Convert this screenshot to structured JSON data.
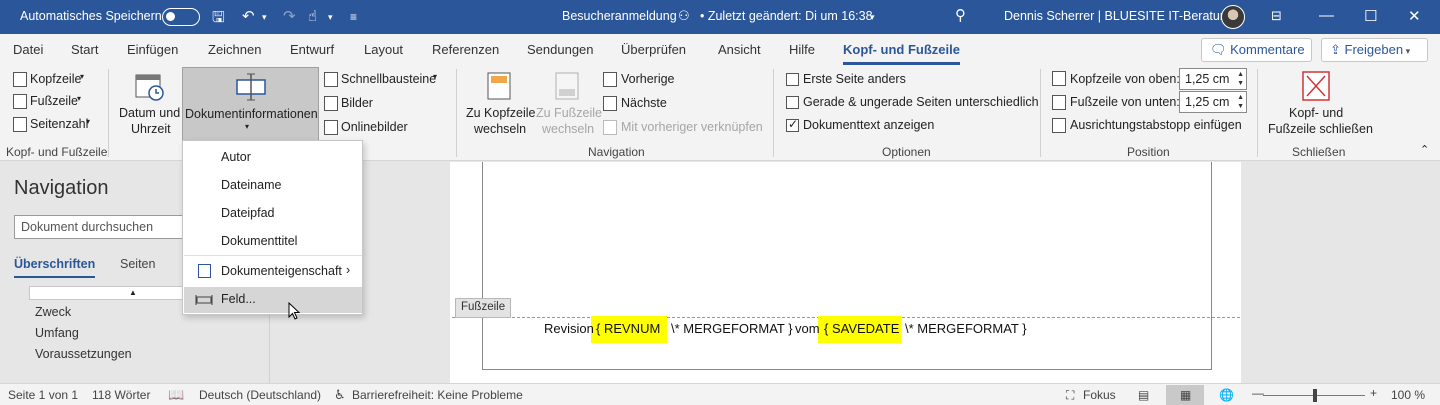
{
  "titlebar": {
    "autosave_label": "Automatisches Speichern",
    "doc_title": "Besucheranmeldung",
    "changed": "• Zuletzt geändert: Di um 16:38",
    "user": "Dennis Scherrer | BLUESITE IT-Beratung"
  },
  "tabs": [
    "Datei",
    "Start",
    "Einfügen",
    "Zeichnen",
    "Entwurf",
    "Layout",
    "Referenzen",
    "Sendungen",
    "Überprüfen",
    "Ansicht",
    "Hilfe",
    "Kopf- und Fußzeile"
  ],
  "actions": {
    "comments": "Kommentare",
    "share": "Freigeben"
  },
  "ribbon": {
    "header": "Kopfzeile",
    "footer": "Fußzeile",
    "page_number": "Seitenzahl",
    "group1": "Kopf- und Fußzeile",
    "date_time_1": "Datum und",
    "date_time_2": "Uhrzeit",
    "docinfo": "Dokumentinformationen",
    "quickparts": "Schnellbausteine",
    "pictures": "Bilder",
    "online_pictures": "Onlinebilder",
    "goto_header_1": "Zu Kopfzeile",
    "goto_header_2": "wechseln",
    "goto_footer_1": "Zu Fußzeile",
    "goto_footer_2": "wechseln",
    "previous": "Vorherige",
    "next": "Nächste",
    "link_previous": "Mit vorheriger verknüpfen",
    "group_nav": "Navigation",
    "opt_first": "Erste Seite anders",
    "opt_oddeven": "Gerade & ungerade Seiten unterschiedlich",
    "opt_showtext": "Dokumenttext anzeigen",
    "group_options": "Optionen",
    "header_from_top": "Kopfzeile von oben:",
    "footer_from_bottom": "Fußzeile von unten:",
    "header_value": "1,25 cm",
    "footer_value": "1,25 cm",
    "insert_tab": "Ausrichtungstabstopp einfügen",
    "group_position": "Position",
    "close_1": "Kopf- und",
    "close_2": "Fußzeile schließen",
    "group_close": "Schließen"
  },
  "dropdown": [
    "Autor",
    "Dateiname",
    "Dateipfad",
    "Dokumenttitel",
    "Dokumenteigenschaft",
    "Feld..."
  ],
  "nav": {
    "title": "Navigation",
    "search_placeholder": "Dokument durchsuchen",
    "tab_headings": "Überschriften",
    "tab_pages": "Seiten",
    "items": [
      "Zweck",
      "Umfang",
      "Voraussetzungen"
    ]
  },
  "document": {
    "footer_tag": "Fußzeile",
    "t_revision": "Revision",
    "f_revnum": "{ REVNUM ",
    "t_merge1": "\\* MERGEFORMAT }",
    "t_vom": "vom",
    "f_savedate": "{ SAVEDATE ",
    "t_merge2": "\\* MERGEFORMAT }"
  },
  "status": {
    "page": "Seite 1 von 1",
    "words": "118 Wörter",
    "lang": "Deutsch (Deutschland)",
    "access": "Barrierefreiheit: Keine Probleme",
    "focus": "Fokus",
    "zoom": "100 %"
  },
  "colors": {
    "brand": "#2b579a",
    "highlight": "#ffff00"
  }
}
